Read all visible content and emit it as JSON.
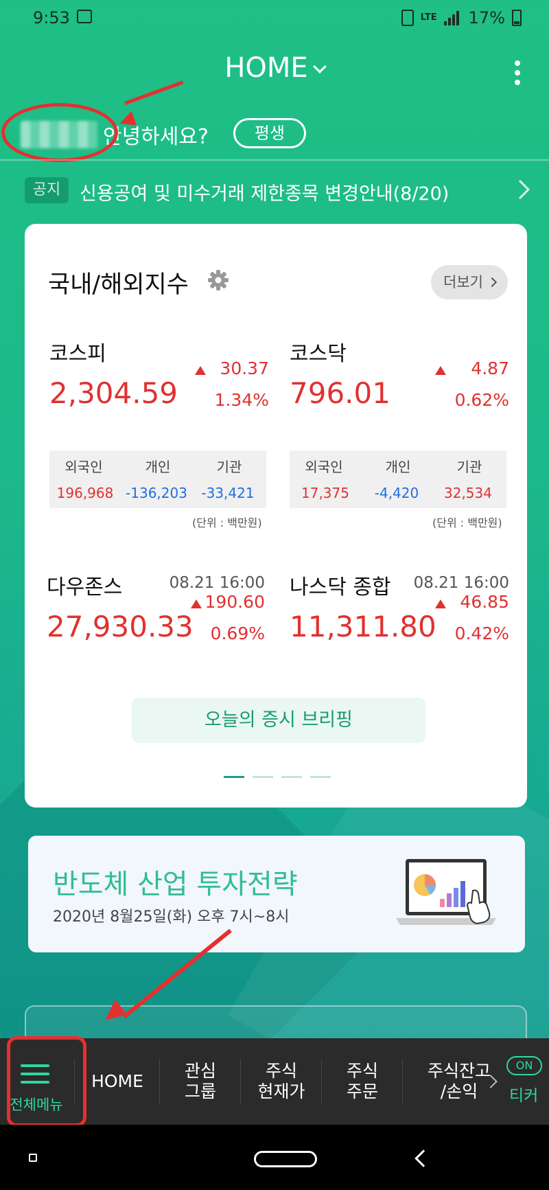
{
  "status_bar": {
    "time": "9:53",
    "network": "LTE",
    "battery": "17%"
  },
  "header": {
    "title": "HOME"
  },
  "greeting": {
    "text": "안녕하세요?",
    "grade": "평생"
  },
  "notice": {
    "tag": "공지",
    "text": "신용공여 및 미수거래 제한종목 변경안내(8/20)"
  },
  "index_card": {
    "title": "국내/해외지수",
    "more_label": "더보기",
    "unit_label": "(단위 : 백만원)",
    "flow_headers": [
      "외국인",
      "개인",
      "기관"
    ],
    "kospi": {
      "name": "코스피",
      "value": "2,304.59",
      "change": "30.37",
      "pct": "1.34%",
      "flows": [
        "196,968",
        "-136,203",
        "-33,421"
      ]
    },
    "kosdaq": {
      "name": "코스닥",
      "value": "796.01",
      "change": "4.87",
      "pct": "0.62%",
      "flows": [
        "17,375",
        "-4,420",
        "32,534"
      ]
    },
    "dow": {
      "name": "다우존스",
      "time": "08.21 16:00",
      "value": "27,930.33",
      "change": "190.60",
      "pct": "0.69%"
    },
    "nasdaq": {
      "name": "나스닥 종합",
      "time": "08.21 16:00",
      "value": "11,311.80",
      "change": "46.85",
      "pct": "0.42%"
    },
    "briefing_label": "오늘의 증시 브리핑",
    "pages": 4,
    "active_page": 1
  },
  "banner": {
    "title": "반도체 산업 투자전략",
    "subtitle": "2020년 8월25일(화) 오후 7시~8시"
  },
  "bottom_nav": {
    "menu_label": "전체메뉴",
    "home": "HOME",
    "watch": "관심\n그룹",
    "price": "주식\n현재가",
    "order": "주식\n주문",
    "balance": "주식잔고\n/손익",
    "on_badge": "ON",
    "ticker": "티커"
  },
  "colors": {
    "accent": "#1fbf85",
    "up": "#e03131",
    "down": "#1e6fe0",
    "annotation": "#e53030"
  }
}
